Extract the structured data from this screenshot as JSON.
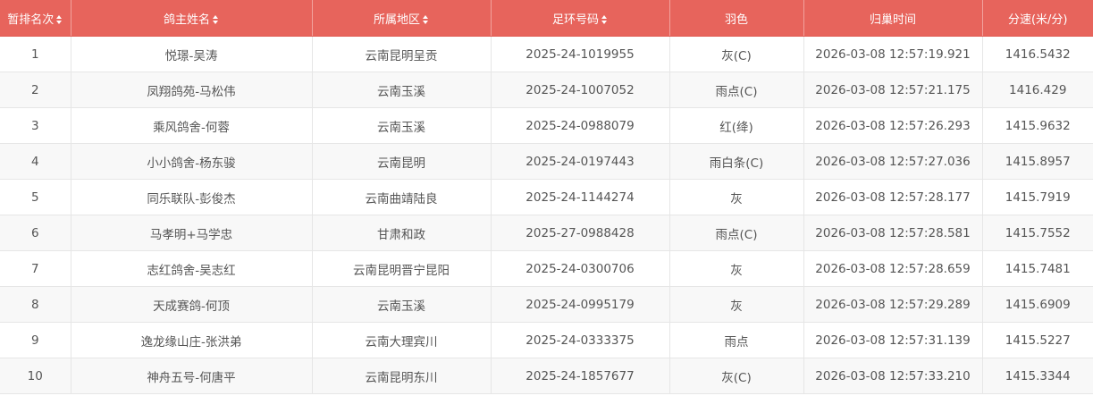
{
  "table": {
    "columns": [
      {
        "label": "暂排名次",
        "sortable": true
      },
      {
        "label": "鸽主姓名",
        "sortable": true
      },
      {
        "label": "所属地区",
        "sortable": true
      },
      {
        "label": "足环号码",
        "sortable": true
      },
      {
        "label": "羽色",
        "sortable": false
      },
      {
        "label": "归巢时间",
        "sortable": false
      },
      {
        "label": "分速(米/分)",
        "sortable": false
      }
    ],
    "rows": [
      [
        "1",
        "悦璟-吴涛",
        "云南昆明呈贡",
        "2025-24-1019955",
        "灰(C)",
        "2026-03-08 12:57:19.921",
        "1416.5432"
      ],
      [
        "2",
        "凤翔鸽苑-马松伟",
        "云南玉溪",
        "2025-24-1007052",
        "雨点(C)",
        "2026-03-08 12:57:21.175",
        "1416.429"
      ],
      [
        "3",
        "乘风鸽舍-何蓉",
        "云南玉溪",
        "2025-24-0988079",
        "红(绛)",
        "2026-03-08 12:57:26.293",
        "1415.9632"
      ],
      [
        "4",
        "小小鸽舍-杨东骏",
        "云南昆明",
        "2025-24-0197443",
        "雨白条(C)",
        "2026-03-08 12:57:27.036",
        "1415.8957"
      ],
      [
        "5",
        "同乐联队-彭俊杰",
        "云南曲靖陆良",
        "2025-24-1144274",
        "灰",
        "2026-03-08 12:57:28.177",
        "1415.7919"
      ],
      [
        "6",
        "马孝明+马学忠",
        "甘肃和政",
        "2025-27-0988428",
        "雨点(C)",
        "2026-03-08 12:57:28.581",
        "1415.7552"
      ],
      [
        "7",
        "志红鸽舍-吴志红",
        "云南昆明晋宁昆阳",
        "2025-24-0300706",
        "灰",
        "2026-03-08 12:57:28.659",
        "1415.7481"
      ],
      [
        "8",
        "天成赛鸽-何顶",
        "云南玉溪",
        "2025-24-0995179",
        "灰",
        "2026-03-08 12:57:29.289",
        "1415.6909"
      ],
      [
        "9",
        "逸龙缘山庄-张洪弟",
        "云南大理宾川",
        "2025-24-0333375",
        "雨点",
        "2026-03-08 12:57:31.139",
        "1415.5227"
      ],
      [
        "10",
        "神舟五号-何唐平",
        "云南昆明东川",
        "2025-24-1857677",
        "灰(C)",
        "2026-03-08 12:57:33.210",
        "1415.3344"
      ]
    ]
  },
  "colors": {
    "header_bg": "#e7645c",
    "header_text": "#ffffff",
    "row_alt_bg": "#f8f8f8",
    "cell_text": "#555555",
    "border": "#e6e6e6"
  },
  "icons": {
    "sort": "sort-icon"
  }
}
